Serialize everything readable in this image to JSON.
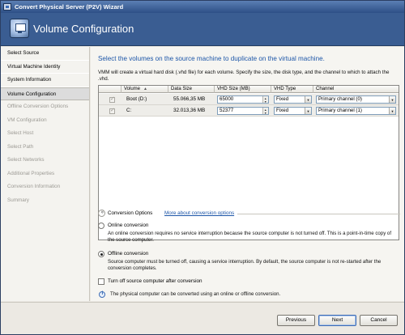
{
  "window": {
    "title": "Convert Physical Server (P2V) Wizard"
  },
  "header": {
    "title": "Volume Configuration"
  },
  "sidebar": {
    "items": [
      {
        "label": "Select Source",
        "state": "normal"
      },
      {
        "label": "Virtual Machine Identity",
        "state": "normal"
      },
      {
        "label": "System Information",
        "state": "normal"
      },
      {
        "label": "Volume Configuration",
        "state": "active"
      },
      {
        "label": "Offline Conversion Options",
        "state": "dim"
      },
      {
        "label": "VM Configuration",
        "state": "dim"
      },
      {
        "label": "Select Host",
        "state": "dim"
      },
      {
        "label": "Select Path",
        "state": "dim"
      },
      {
        "label": "Select Networks",
        "state": "dim"
      },
      {
        "label": "Additional Properties",
        "state": "dim"
      },
      {
        "label": "Conversion Information",
        "state": "dim"
      },
      {
        "label": "Summary",
        "state": "dim"
      }
    ]
  },
  "main": {
    "heading": "Select the volumes on the source machine to duplicate on the virtual machine.",
    "description": "VMM will create a virtual hard disk (.vhd file) for each volume. Specify the size, the disk type, and the channel to which to attach the .vhd.",
    "table": {
      "columns": [
        "Volume",
        "Data Size",
        "VHD Size (MB)",
        "VHD Type",
        "Channel"
      ],
      "rows": [
        {
          "volume": "Boot (D:)",
          "data_size": "55.066,35 MB",
          "vhd_size": "65000",
          "vhd_type": "Fixed",
          "channel": "Primary channel (0)"
        },
        {
          "volume": "C:",
          "data_size": "32.013,36 MB",
          "vhd_size": "52377",
          "vhd_type": "Fixed",
          "channel": "Primary channel (1)"
        }
      ]
    },
    "conversion_options": {
      "title": "Conversion Options",
      "link": "More about conversion options",
      "online_label": "Online conversion",
      "online_desc": "An online conversion requires no service interruption because the source computer is not turned off. This is a point-in-time copy of the source computer.",
      "offline_label": "Offline conversion",
      "offline_desc": "Source computer must be turned off, causing a service interruption. By default, the source computer is not re-started after the conversion completes.",
      "selected": "offline",
      "turn_off_label": "Turn off source computer after conversion",
      "info": "The physical computer can be converted using an online or offline conversion."
    }
  },
  "footer": {
    "previous": "Previous",
    "next": "Next",
    "cancel": "Cancel"
  }
}
